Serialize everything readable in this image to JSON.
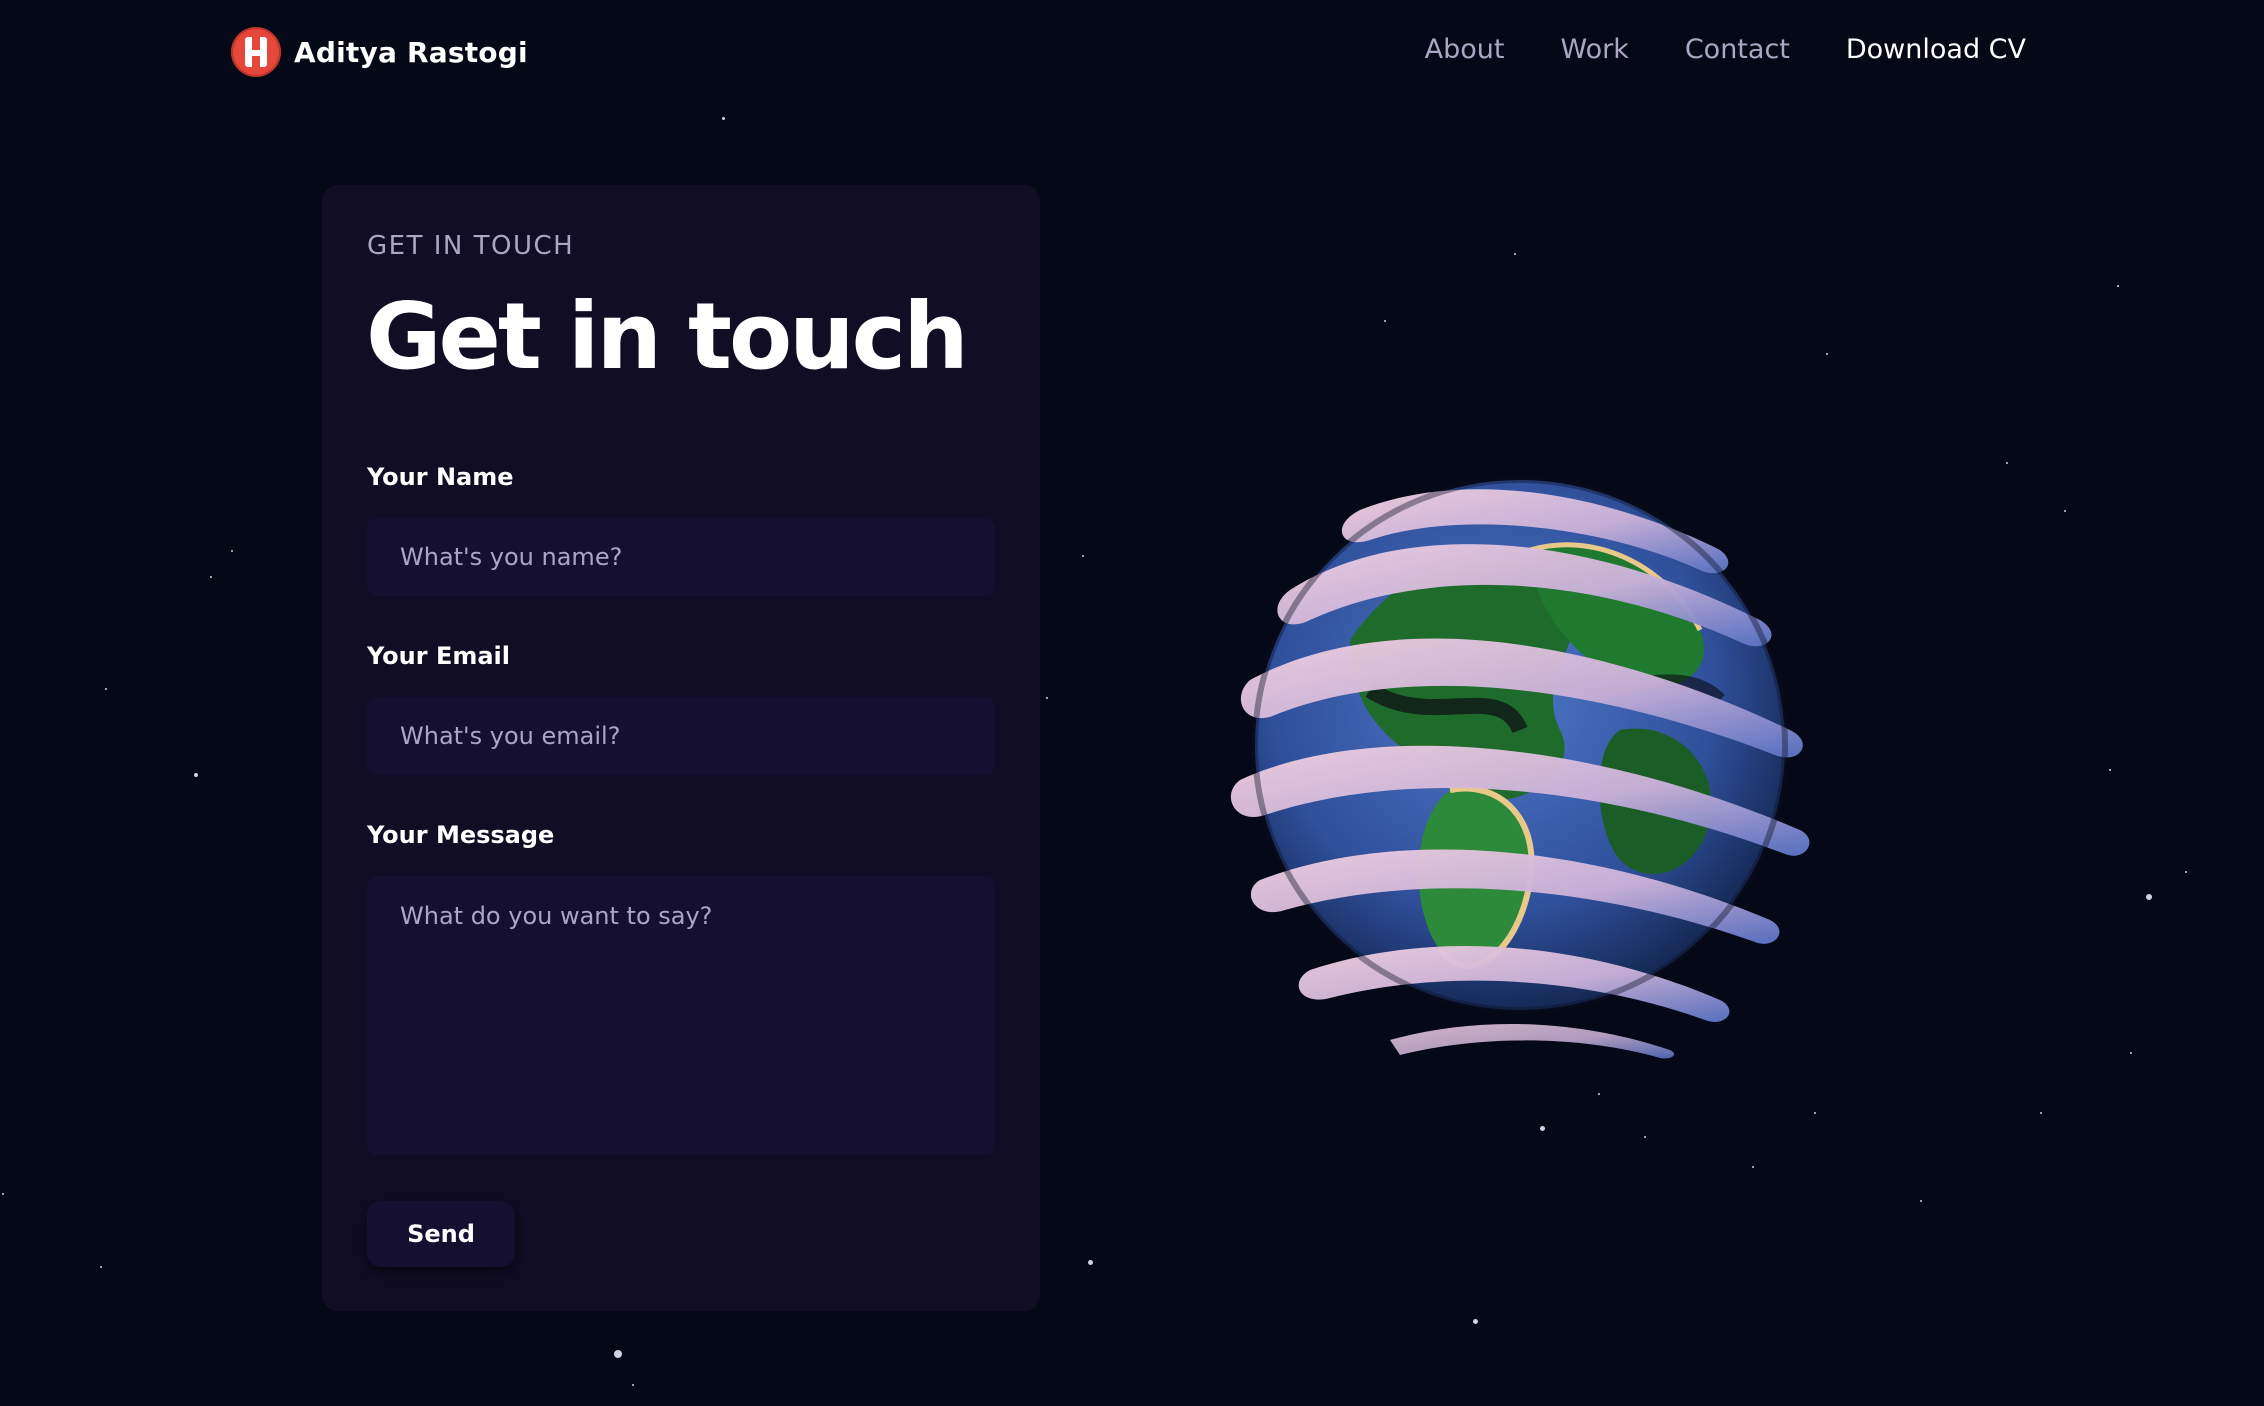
{
  "nav": {
    "brand_name": "Aditya Rastogi",
    "links": [
      "About",
      "Work",
      "Contact",
      "Download CV"
    ]
  },
  "contact": {
    "eyebrow": "GET IN TOUCH",
    "heading": "Get in touch",
    "name_label": "Your Name",
    "name_placeholder": "What's you name?",
    "email_label": "Your Email",
    "email_placeholder": "What's you email?",
    "message_label": "Your Message",
    "message_placeholder": "What do you want to say?",
    "send_label": "Send"
  },
  "colors": {
    "background": "#050816",
    "card": "#100d25",
    "field": "#151030",
    "secondary_text": "#aaa6c3",
    "logo": "#e5473a"
  }
}
